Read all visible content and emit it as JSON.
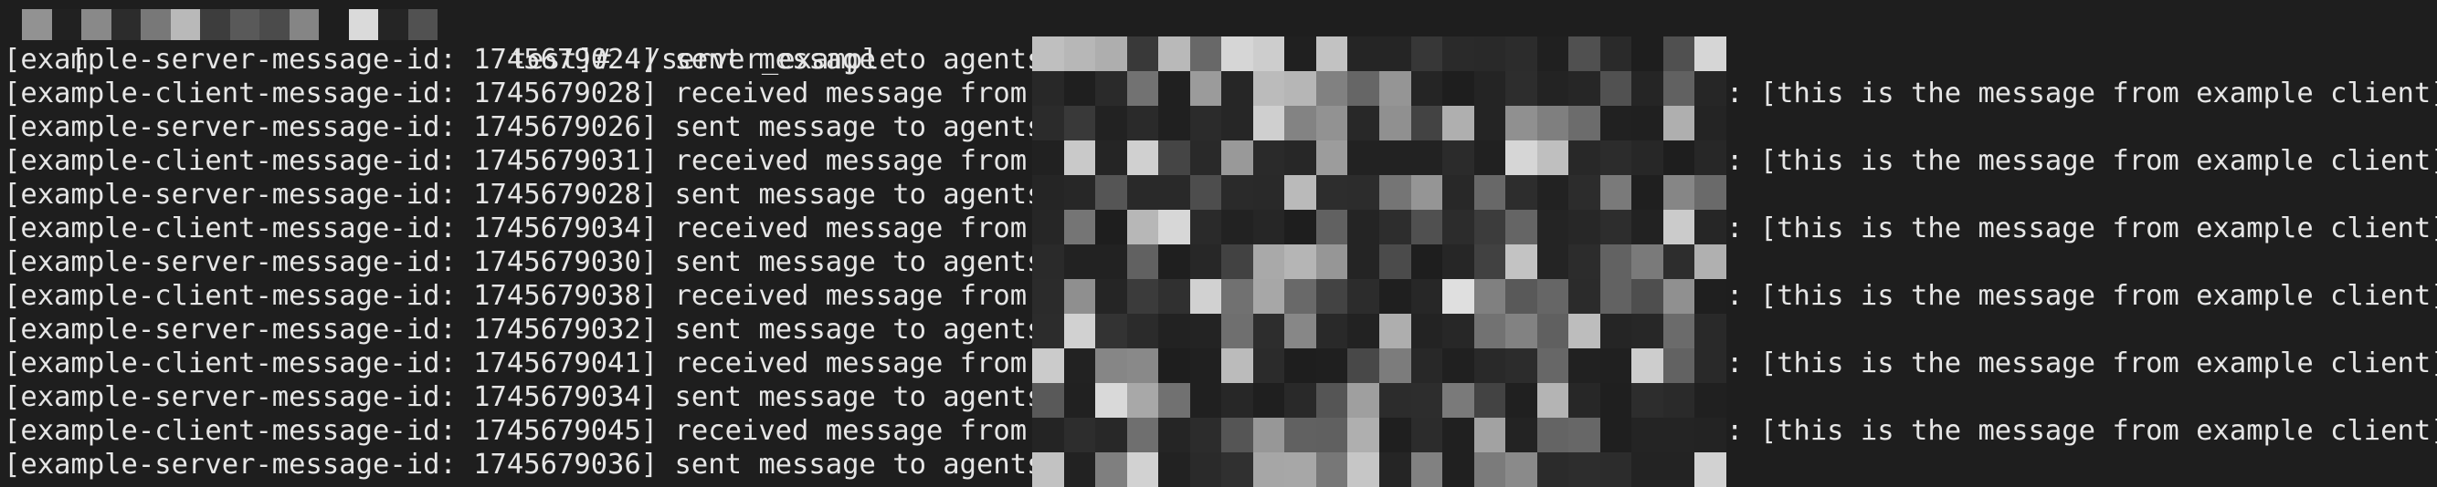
{
  "terminal": {
    "prompt": {
      "open_bracket": "[",
      "suffix": "test]# ./server_example"
    },
    "lines": [
      {
        "text": "[example-server-message-id: 1745679024] sent message to agents(",
        "tail": ""
      },
      {
        "text": "[example-client-message-id: 1745679028] received message from a",
        "tail": ": [this is the message from example client]"
      },
      {
        "text": "[example-server-message-id: 1745679026] sent message to agents(",
        "tail": ""
      },
      {
        "text": "[example-client-message-id: 1745679031] received message from a",
        "tail": ": [this is the message from example client]"
      },
      {
        "text": "[example-server-message-id: 1745679028] sent message to agents(",
        "tail": ""
      },
      {
        "text": "[example-client-message-id: 1745679034] received message from a",
        "tail": ": [this is the message from example client]"
      },
      {
        "text": "[example-server-message-id: 1745679030] sent message to agents(",
        "tail": ""
      },
      {
        "text": "[example-client-message-id: 1745679038] received message from a",
        "tail": ": [this is the message from example client]"
      },
      {
        "text": "[example-server-message-id: 1745679032] sent message to agents(",
        "tail": ""
      },
      {
        "text": "[example-client-message-id: 1745679041] received message from a",
        "tail": ": [this is the message from example client]"
      },
      {
        "text": "[example-server-message-id: 1745679034] sent message to agents(",
        "tail": ""
      },
      {
        "text": "[example-client-message-id: 1745679045] received message from a",
        "tail": ": [this is the message from example client]"
      },
      {
        "text": "[example-server-message-id: 1745679036] sent message to agents(",
        "tail": ""
      }
    ]
  },
  "colors": {
    "background": "#1e1e1e",
    "foreground": "#e6e6e6"
  }
}
